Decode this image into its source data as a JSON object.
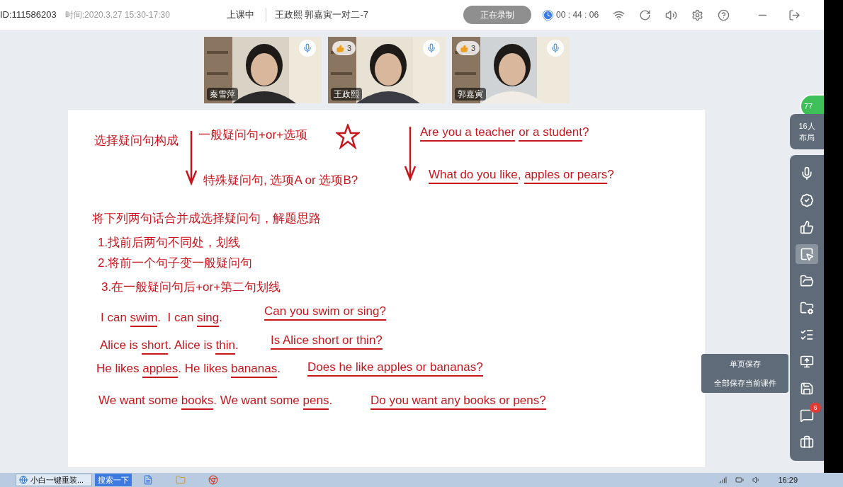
{
  "top_bar": {
    "id": "ID:111586203",
    "time": "时间:2020.3.27 15:30-17:30",
    "status": "上课中",
    "class_name": "王政熙 郭嘉寅一对二-7",
    "record_button": "正在录制",
    "timer": "00 : 44 : 06"
  },
  "videos": [
    {
      "name": "秦雪萍"
    },
    {
      "name": "王政熙",
      "likes": "3"
    },
    {
      "name": "郭嘉寅",
      "likes": "3"
    }
  ],
  "whiteboard": {
    "items": [
      {
        "kind": "text",
        "segments": [
          {
            "text": "选择疑问句构成",
            "underlined": false
          }
        ]
      },
      {
        "kind": "text",
        "segments": [
          {
            "text": "一般疑问句+or+选项",
            "underlined": false
          }
        ]
      },
      {
        "kind": "star"
      },
      {
        "kind": "arrow"
      },
      {
        "kind": "text",
        "segments": [
          {
            "text": "特殊疑问句, 选项A or 选项B?",
            "underlined": false
          }
        ]
      },
      {
        "kind": "arrow"
      },
      {
        "kind": "text",
        "segments": [
          {
            "text": "Are you a teacher",
            "underlined": true
          },
          {
            "text": "or a student",
            "underlined": true
          },
          {
            "text": "?",
            "underlined": false
          }
        ]
      },
      {
        "kind": "text",
        "segments": [
          {
            "text": "What do you like",
            "underlined": true
          },
          {
            "text": ", ",
            "underlined": false
          },
          {
            "text": "apples or pears",
            "underlined": true
          },
          {
            "text": "?",
            "underlined": false
          }
        ]
      },
      {
        "kind": "text",
        "segments": [
          {
            "text": "将下列两句话合并成选择疑问句，解题思路",
            "underlined": false
          }
        ]
      },
      {
        "kind": "text",
        "segments": [
          {
            "text": "1.找前后两句不同处，划线",
            "underlined": false
          }
        ]
      },
      {
        "kind": "text",
        "segments": [
          {
            "text": "2.将前一个句子变一般疑问句",
            "underlined": false
          }
        ]
      },
      {
        "kind": "text",
        "segments": [
          {
            "text": "3.在一般疑问句后+or+第二句划线",
            "underlined": false
          }
        ]
      },
      {
        "kind": "text",
        "segments": [
          {
            "text": "I can ",
            "underlined": false
          },
          {
            "text": "swim",
            "underlined": true
          },
          {
            "text": ".  I can ",
            "underlined": false
          },
          {
            "text": "sing",
            "underlined": true
          },
          {
            "text": ".",
            "underlined": false
          }
        ]
      },
      {
        "kind": "text",
        "segments": [
          {
            "text": "Can you swim or sing?",
            "underlined": true
          }
        ]
      },
      {
        "kind": "text",
        "segments": [
          {
            "text": "Alice is ",
            "underlined": false
          },
          {
            "text": "short",
            "underlined": true
          },
          {
            "text": ". Alice is ",
            "underlined": false
          },
          {
            "text": "thin",
            "underlined": true
          },
          {
            "text": ".",
            "underlined": false
          }
        ]
      },
      {
        "kind": "text",
        "segments": [
          {
            "text": "Is Alice short or thin?",
            "underlined": true
          }
        ]
      },
      {
        "kind": "text",
        "segments": [
          {
            "text": "He likes ",
            "underlined": false
          },
          {
            "text": "apples",
            "underlined": true
          },
          {
            "text": ". He likes ",
            "underlined": false
          },
          {
            "text": "bananas",
            "underlined": true
          },
          {
            "text": ".",
            "underlined": false
          }
        ]
      },
      {
        "kind": "text",
        "segments": [
          {
            "text": "Does he like apples or bananas?",
            "underlined": true
          }
        ]
      },
      {
        "kind": "text",
        "segments": [
          {
            "text": "We want some ",
            "underlined": false
          },
          {
            "text": "books",
            "underlined": true
          },
          {
            "text": ". We want some ",
            "underlined": false
          },
          {
            "text": "pens",
            "underlined": true
          },
          {
            "text": ".",
            "underlined": false
          }
        ]
      },
      {
        "kind": "text",
        "segments": [
          {
            "text": "Do you want any books or pens?",
            "underlined": true
          }
        ]
      }
    ]
  },
  "online_count": "77",
  "layout_button": "16人布局",
  "tools": [
    {
      "kind": "mic",
      "selected": false
    },
    {
      "kind": "verify",
      "selected": false
    },
    {
      "kind": "like",
      "selected": false
    },
    {
      "kind": "pointer",
      "selected": true
    },
    {
      "kind": "folder",
      "selected": false
    },
    {
      "kind": "folder-settings",
      "selected": false
    },
    {
      "kind": "list",
      "selected": false
    },
    {
      "kind": "share",
      "selected": false
    },
    {
      "kind": "save",
      "selected": false
    },
    {
      "kind": "chat",
      "selected": false,
      "badge": "6"
    },
    {
      "kind": "toolbox",
      "selected": false
    }
  ],
  "save_menu": [
    "单页保存",
    "全部保存当前课件"
  ],
  "taskbar": {
    "window": "小白一键重装...",
    "search_button": "搜索一下",
    "clock": "16:29"
  }
}
